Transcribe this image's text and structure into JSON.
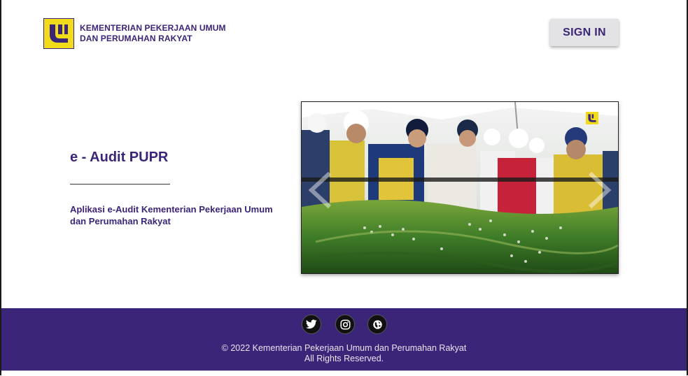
{
  "header": {
    "org_line1": "KEMENTERIAN PEKERJAAN UMUM",
    "org_line2": "DAN PERUMAHAN RAKYAT",
    "logo_icon": "pupr-logo",
    "signin_label": "SIGN IN"
  },
  "hero": {
    "title": "e - Audit PUPR",
    "description": "Aplikasi e-Audit Kementerian Pekerjaan Umum dan Perumahan Rakyat"
  },
  "carousel": {
    "image": "officials-viewing-landscape-model",
    "prev_icon": "chevron-left-icon",
    "next_icon": "chevron-right-icon"
  },
  "footer": {
    "social": [
      {
        "icon": "twitter-icon"
      },
      {
        "icon": "instagram-icon"
      },
      {
        "icon": "globe-icon"
      }
    ],
    "copyright_line1": "© 2022 Kementerian Pekerjaan Umum dan Perumahan Rakyat",
    "copyright_line2": "All Rights Reserved."
  },
  "colors": {
    "brand_purple": "#3b2578",
    "logo_yellow": "#f2dc1a",
    "button_gray": "#e3e3e6"
  }
}
